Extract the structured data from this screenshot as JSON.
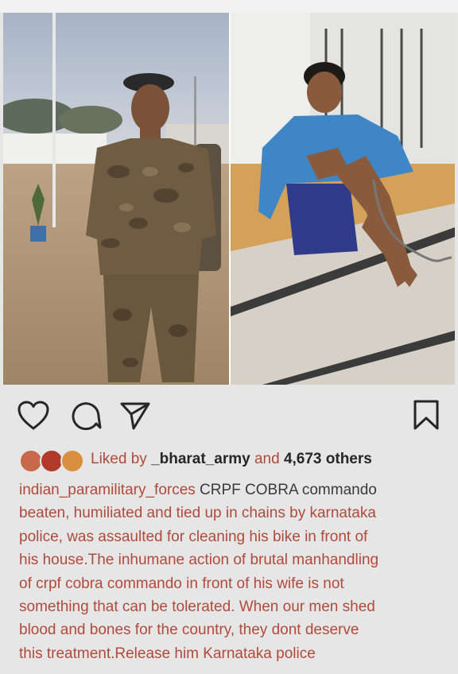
{
  "post": {
    "liked_by_prefix": "Liked by ",
    "liked_by_user": "_bharat_army",
    "liked_by_and": " and ",
    "liked_by_others": "4,673 others",
    "author": "indian_paramilitary_forces",
    "caption_lines": [
      " CRPF COBRA commando",
      "beaten, humiliated and tied up in chains by karnataka",
      "police, was assaulted for cleaning his bike in front of",
      "his house.The inhumane action of brutal manhandling",
      "of crpf cobra commando in front of his wife is not",
      "something that can be tolerated. When our men shed",
      "blood and bones for the country, they dont deserve",
      "this treatment.Release him Karnataka police"
    ]
  },
  "icons": {
    "like": "heart-icon",
    "comment": "comment-icon",
    "share": "paper-plane-icon",
    "save": "bookmark-icon"
  },
  "colors": {
    "caption_text": "#b14a3a",
    "bold_text": "#262626",
    "background": "#e6e6e6"
  }
}
